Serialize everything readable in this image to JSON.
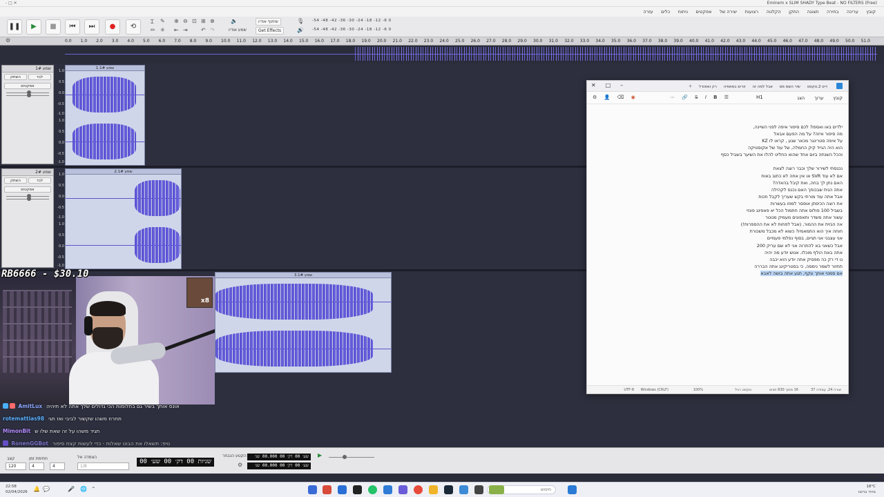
{
  "window": {
    "title": "(Free) Eminem x SLIM SHADY Type Beat - NO FILTERS",
    "controls": "- □ ✕"
  },
  "menubar": [
    "קובץ",
    "עריכה",
    "בחירה",
    "תצוגה",
    "התקן",
    "הקלטה",
    "רצועות",
    "יצירה של",
    "אפקטים",
    "ניתוח",
    "כלים",
    "עזרה"
  ],
  "toolbar": {
    "pause": "❚❚",
    "play": "▶",
    "stop": "■",
    "skip_start": "⏮",
    "skip_end": "⏭",
    "record": "●",
    "loop": "⟲",
    "audio_setup": "שמע אודיו",
    "share_audio": "שיתוף אודיו",
    "get_effects": "Get Effects",
    "meter_top": "-54 -48 -42 -36 -30 -24 -18 -12 -6 0",
    "meter_bottom": "-54 -48 -42 -36 -30 -24 -18 -12 -6 0"
  },
  "ruler": [
    "0.0",
    "1.0",
    "2.0",
    "3.0",
    "4.0",
    "5.0",
    "6.0",
    "7.0",
    "8.0",
    "9.0",
    "10.0",
    "11.0",
    "12.0",
    "13.0",
    "14.0",
    "15.0",
    "16.0",
    "17.0",
    "18.0",
    "19.0",
    "20.0",
    "21.0",
    "22.0",
    "23.0",
    "24.0",
    "25.0",
    "26.0",
    "27.0",
    "28.0",
    "29.0",
    "30.0",
    "31.0",
    "32.0",
    "33.0",
    "34.0",
    "35.0",
    "36.0",
    "37.0",
    "38.0",
    "39.0",
    "40.0",
    "41.0",
    "42.0",
    "43.0",
    "44.0",
    "45.0",
    "46.0",
    "47.0",
    "48.0",
    "49.0",
    "50.0",
    "51.0"
  ],
  "tracks": [
    {
      "name": "שמע 1#",
      "mute": "השתק",
      "solo": "לבד",
      "effects": "אפקטים",
      "clip": "שמע 1.1#"
    },
    {
      "name": "שמע 2#",
      "mute": "השתק",
      "solo": "לבד",
      "effects": "אפקטים",
      "clip": "שמע 2.1#"
    },
    {
      "name": "שמע 3#",
      "clip": "שמע 3.1#"
    }
  ],
  "scale": {
    "p1": "1.0",
    "p05": "0.5",
    "z": "0.0",
    "m05": "-0.5",
    "m1": "-1.0"
  },
  "notepad": {
    "tabs": [
      "דיס 2.טקסט",
      "שיר השמ מס",
      "אבל למה זה",
      "זורים במאפיה",
      "רק ואפנדל"
    ],
    "menu_file": "קובץ",
    "menu_edit": "ערוך",
    "menu_view": "הצג",
    "heading": "H1",
    "lines": [
      "ילדים באו ואספו? לכם סיפור איפה לפני השיינה,",
      "מה סיפור איזה? על מה הפעם אבאל",
      "על איפה סטרינגר מכאר שגע , קראו לו KZ",
      "הוא היה הגייד קיק החמלה, של עוד של אקוסטיקה",
      "והכל השנתה ביום אחד שהוא החליט להלו את השיער בשביל כסף",
      "",
      "נכנסתי לשירור שלך וכבר רוצה לצאת",
      "אם לא עוד SVR או אין אחה לא כתוב באות",
      "האם נתן לך בחה, ואת קיבל בהאדה?",
      "אתה הגית שבכוחך האם נכנס לקהילה",
      "אבל אתה עוד מורתי בקש שעריך לקבל חכות",
      "את רוצה הכיסתן אופסר למוזו בעשרות",
      "בשביל 100 פולוס אתה חתמול הכל יא פאפינג פונזי",
      "עשור אתה משדר ותאפונים מעמיק מנוטר",
      "אה הגזית את ההמור, (אבל לפחות לא את ההספרות!)",
      "חוחה איך הוא התמאמיו? כשוא לא מכבל משכורת",
      "אני עצבני אני תגיים, בסוף נפלמי פעמיים",
      "אבל כשאני בא להתרוה אני לא שם עריק 200",
      "אתה באת הולף מוכלו. אנוש יודע מה יהיה",
      "נו די רק כה מפסיק אתה יודע הוא יכבה",
      "תחזור לשמר נימסה, כי בסטריקינג אתה הבררה",
      "אם סמטי אותך עקף, תגע אתה בושה לאבא"
    ],
    "status": {
      "position": "שורה 24, עמודה 37",
      "chars": "16 מתוך 830 תווים",
      "format": "טקסט רגיל",
      "zoom": "100%",
      "eol": "Windows (CRLF)",
      "encoding": "UTF-8"
    }
  },
  "donation": "RB6666 - $30.10",
  "badge_multiplier": "x8",
  "chat": [
    {
      "user": "AmitLux",
      "text": "אונס אותך בשיר גם בחלומות הכי גדולים שלך אתה לא תיהיה",
      "color": "#8fb0ff"
    },
    {
      "user": "rotemattias98",
      "text": "תחרוז משהו שקשור לביבי ואז תגי",
      "color": "#5ab0ff"
    },
    {
      "user": "MimonBit",
      "text": "תגיד משהו על זה שאת שלו ש",
      "color": "#b48cff"
    },
    {
      "user": "RonenGGBot",
      "text": "טיפ: תשאלו את הבוט שאלות - כדי לעשות קצת סיפור",
      "color": "#9a8cff"
    }
  ],
  "bottombar": {
    "tempo_label": "קצב",
    "tempo": "120",
    "timesig_label": "חתימת זמן",
    "timesig_a": "4",
    "timesig_b": "4",
    "snap_label": "הצמדה אל",
    "snap_value": "1/8",
    "main_time": "שניות 00 דק׳ 00 שע׳ 00",
    "sel_label": "הקטע הנבחר",
    "sel_start": "שע׳ 00 דק׳ 00 00.000 שנ׳",
    "sel_end": "שע׳ 00 דק׳ 00 00.000 שנ׳"
  },
  "statusline": "עצר.",
  "taskbar": {
    "time": "22:58",
    "date": "02/04/2026",
    "search": "חיפוש",
    "weather_temp": "18°C",
    "weather_desc": "בהיר ברובו"
  },
  "colors": {
    "waveform": "#5a52d0",
    "track_bg": "#2d2f3e",
    "clip_bg": "#cfd6ea"
  }
}
